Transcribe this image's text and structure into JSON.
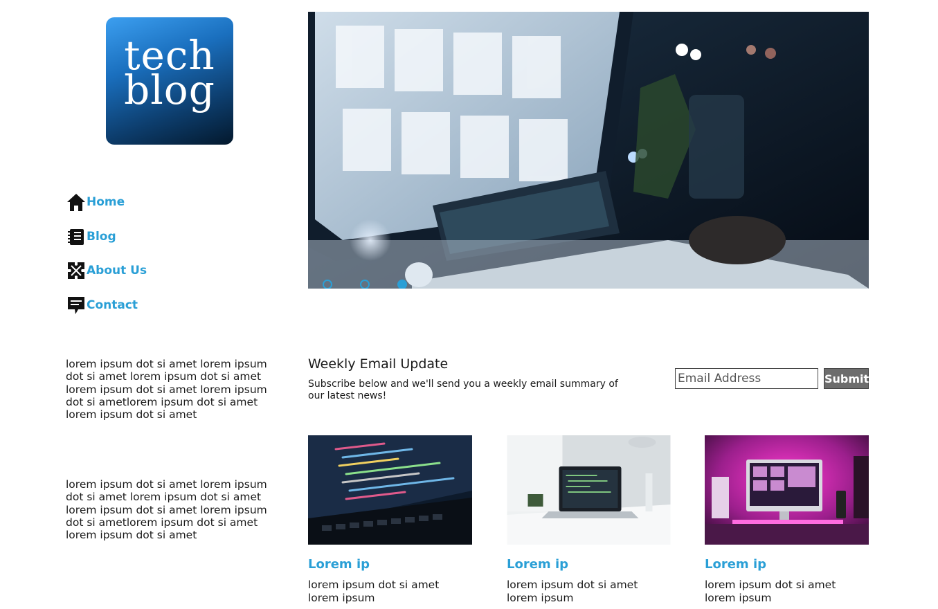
{
  "logo": {
    "line1": "tech",
    "line2": "blog"
  },
  "nav": {
    "items": [
      {
        "label": "Home",
        "icon": "home-icon"
      },
      {
        "label": "Blog",
        "icon": "notebook-icon"
      },
      {
        "label": "About Us",
        "icon": "puzzle-icon"
      },
      {
        "label": "Contact",
        "icon": "message-icon"
      }
    ]
  },
  "sidebar": {
    "paragraphs": [
      "lorem ipsum dot si amet lorem ipsum dot si amet lorem ipsum dot si amet lorem ipsum dot si amet lorem ipsum dot si ametlorem ipsum dot si amet lorem ipsum dot si amet",
      "lorem ipsum dot si amet lorem ipsum dot si amet lorem ipsum dot si amet lorem ipsum dot si amet lorem ipsum dot si ametlorem ipsum dot si amet lorem ipsum dot si amet"
    ]
  },
  "carousel": {
    "slide_count": 3,
    "active_index": 2
  },
  "newsletter": {
    "title": "Weekly Email Update",
    "description": "Subscribe below and we'll send you a weekly email summary of our latest news!",
    "email_placeholder": "Email Address",
    "submit_label": "Submit"
  },
  "cards": [
    {
      "title": "Lorem ip",
      "text": "lorem ipsum dot si amet lorem ipsum"
    },
    {
      "title": "Lorem ip",
      "text": "lorem ipsum dot si amet lorem ipsum"
    },
    {
      "title": "Lorem ip",
      "text": "lorem ipsum dot si amet lorem ipsum"
    }
  ],
  "colors": {
    "accent": "#2a9fd6",
    "submit_bg": "#6d6d6d"
  }
}
